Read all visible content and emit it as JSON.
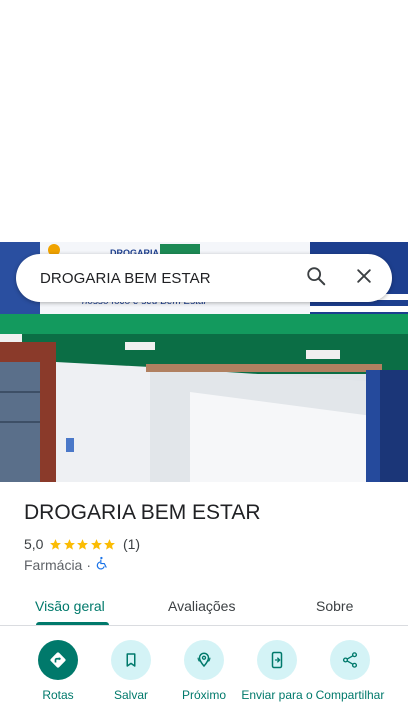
{
  "search": {
    "value": "DROGARIA BEM ESTAR"
  },
  "place": {
    "name": "DROGARIA BEM ESTAR",
    "rating": "5,0",
    "stars": 5,
    "review_count": "(1)",
    "category": "Farmácia",
    "separator": "·"
  },
  "photo": {
    "sign_top": "DROGARIA",
    "sign_tagline": "nosso foco é seu Bem Estar"
  },
  "tabs": [
    {
      "label": "Visão geral",
      "active": true
    },
    {
      "label": "Avaliações",
      "active": false
    },
    {
      "label": "Sobre",
      "active": false
    }
  ],
  "actions": [
    {
      "label": "Rotas",
      "icon": "directions-icon"
    },
    {
      "label": "Salvar",
      "icon": "bookmark-icon"
    },
    {
      "label": "Próximo",
      "icon": "nearby-icon"
    },
    {
      "label": "Enviar para o",
      "icon": "send-to-phone-icon"
    },
    {
      "label": "Compartilhar",
      "icon": "share-icon"
    }
  ],
  "colors": {
    "accent": "#00796b",
    "action_bg": "#d4f3f6",
    "star": "#fbbc04",
    "accessibility": "#1a73e8"
  }
}
